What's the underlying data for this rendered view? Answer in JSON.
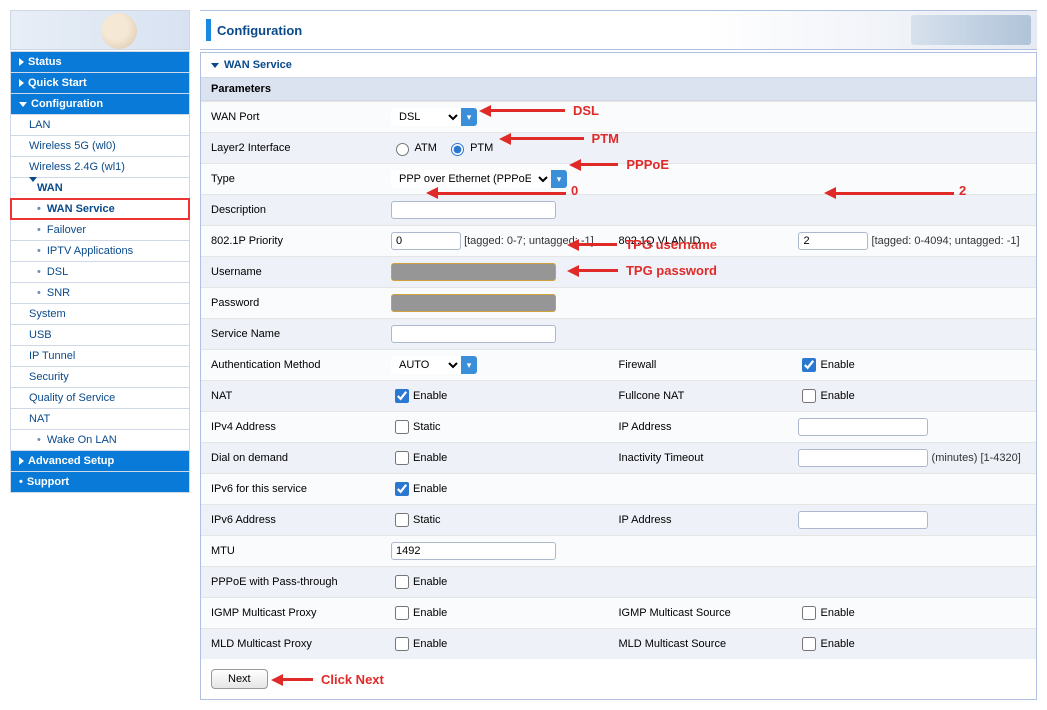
{
  "header": {
    "title": "Configuration"
  },
  "nav": {
    "status": "Status",
    "quick": "Quick Start",
    "config": "Configuration",
    "lan": "LAN",
    "wifi5": "Wireless 5G (wl0)",
    "wifi24": "Wireless 2.4G (wl1)",
    "wan": "WAN",
    "wan_service": "WAN Service",
    "failover": "Failover",
    "iptv": "IPTV Applications",
    "dsl": "DSL",
    "snr": "SNR",
    "system": "System",
    "usb": "USB",
    "iptunnel": "IP Tunnel",
    "security": "Security",
    "qos": "Quality of Service",
    "nat": "NAT",
    "wol": "Wake On LAN",
    "adv": "Advanced Setup",
    "support": "Support"
  },
  "panel": {
    "title": "WAN Service",
    "params": "Parameters",
    "rows": {
      "wan_port": "WAN Port",
      "layer2": "Layer2 Interface",
      "type": "Type",
      "description": "Description",
      "pri": "802.1P Priority",
      "vlan": "802.1Q VLAN ID",
      "user": "Username",
      "pass": "Password",
      "sname": "Service Name",
      "auth": "Authentication Method",
      "fw": "Firewall",
      "natl": "NAT",
      "full": "Fullcone NAT",
      "v4addr": "IPv4 Address",
      "ipaddr": "IP Address",
      "dod": "Dial on demand",
      "inact": "Inactivity Timeout",
      "inact_unit": "(minutes)  [1-4320]",
      "v6svc": "IPv6 for this service",
      "v6addr": "IPv6 Address",
      "mtu": "MTU",
      "passth": "PPPoE with Pass-through",
      "igmpp": "IGMP Multicast Proxy",
      "igmps": "IGMP Multicast Source",
      "mldp": "MLD Multicast Proxy",
      "mlds": "MLD Multicast Source"
    },
    "values": {
      "wan_port": "DSL",
      "atm": "ATM",
      "ptm": "PTM",
      "type": "PPP over Ethernet (PPPoE)",
      "pri": "0",
      "pri_hint": "[tagged: 0-7; untagged: -1]",
      "vlan": "2",
      "vlan_hint": "[tagged: 0-4094; untagged: -1]",
      "auth": "AUTO",
      "enable": "Enable",
      "static": "Static",
      "mtu": "1492",
      "next": "Next"
    }
  },
  "callouts": {
    "dsl": "DSL",
    "ptm": "PTM",
    "ppp": "PPPoE",
    "zero": "0",
    "two": "2",
    "user": "TPG username",
    "pass": "TPG password",
    "next": "Click Next"
  }
}
